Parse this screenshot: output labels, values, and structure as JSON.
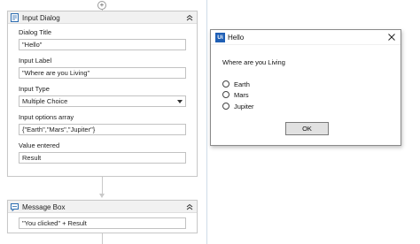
{
  "input_dialog": {
    "title": "Input Dialog",
    "icon": "input-dialog-icon",
    "fields": [
      {
        "label": "Dialog Title",
        "value": "\"Hello\""
      },
      {
        "label": "Input Label",
        "value": "\"Where are you Living\""
      },
      {
        "label": "Input Type",
        "value": "Multiple Choice"
      },
      {
        "label": "Input options array",
        "value": "{\"Earth\",\"Mars\",\"Jupiter\"}"
      },
      {
        "label": "Value entered",
        "value": "Result"
      }
    ]
  },
  "message_box": {
    "title": "Message Box",
    "icon": "message-box-icon",
    "value": "\"You clicked\" + Result"
  },
  "dialog": {
    "logo_text": "Ui",
    "title": "Hello",
    "prompt": "Where are you Living",
    "options": [
      "Earth",
      "Mars",
      "Jupiter"
    ],
    "ok_label": "OK"
  },
  "colors": {
    "logo": "#1f5fb5",
    "header_bg": "#f1f1f1"
  }
}
